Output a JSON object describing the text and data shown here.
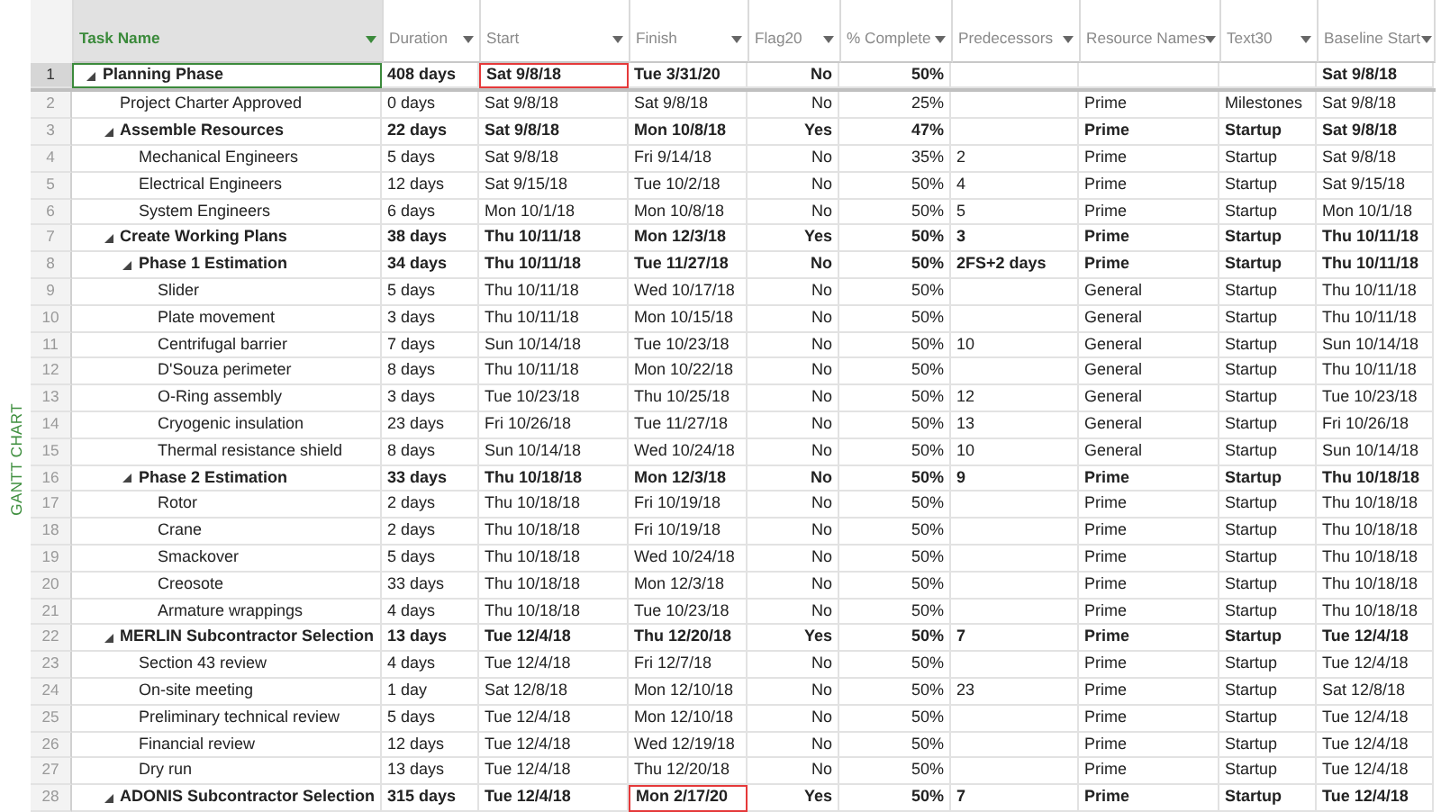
{
  "side_label": "GANTT CHART",
  "columns": [
    {
      "label": "Task Name",
      "selected": true
    },
    {
      "label": "Duration",
      "selected": false
    },
    {
      "label": "Start",
      "selected": false
    },
    {
      "label": "Finish",
      "selected": false
    },
    {
      "label": "Flag20",
      "selected": false
    },
    {
      "label": "% Complete",
      "selected": false
    },
    {
      "label": "Predecessors",
      "selected": false
    },
    {
      "label": "Resource Names",
      "selected": false
    },
    {
      "label": "Text30",
      "selected": false
    },
    {
      "label": "Baseline Start",
      "selected": false
    }
  ],
  "rows": [
    {
      "id": "1",
      "kind": "summary",
      "expanded": true,
      "selected": true,
      "task": "Planning Phase",
      "duration": "408 days",
      "start": {
        "text": "Sat 9/8/18",
        "outlined": true
      },
      "finish": "Tue 3/31/20",
      "flag20": "No",
      "complete": "50%",
      "baseline_start": "Sat 9/8/18",
      "children": [
        {
          "id": "2",
          "kind": "task",
          "selected": false,
          "task": "Project Charter Approved",
          "duration": "0 days",
          "start": "Sat 9/8/18",
          "finish": "Sat 9/8/18",
          "flag20": "No",
          "complete": "25%",
          "resources": "Prime",
          "text30": "Milestones",
          "baseline_start": "Sat 9/8/18"
        },
        {
          "id": "3",
          "kind": "summary",
          "expanded": true,
          "selected": false,
          "task": "Assemble Resources",
          "duration": "22 days",
          "start": "Sat 9/8/18",
          "finish": "Mon 10/8/18",
          "flag20": "Yes",
          "complete": "47%",
          "resources": "Prime",
          "text30": "Startup",
          "baseline_start": "Sat 9/8/18",
          "children": [
            {
              "id": "4",
              "kind": "task",
              "selected": false,
              "task": "Mechanical Engineers",
              "duration": "5 days",
              "start": "Sat 9/8/18",
              "finish": "Fri 9/14/18",
              "flag20": "No",
              "complete": "35%",
              "predecessors": "2",
              "resources": "Prime",
              "text30": "Startup",
              "baseline_start": "Sat 9/8/18"
            },
            {
              "id": "5",
              "kind": "task",
              "selected": false,
              "task": "Electrical Engineers",
              "duration": "12 days",
              "start": "Sat 9/15/18",
              "finish": "Tue 10/2/18",
              "flag20": "No",
              "complete": "50%",
              "predecessors": "4",
              "resources": "Prime",
              "text30": "Startup",
              "baseline_start": "Sat 9/15/18"
            },
            {
              "id": "6",
              "kind": "task",
              "selected": false,
              "task": "System Engineers",
              "duration": "6 days",
              "start": "Mon 10/1/18",
              "finish": "Mon 10/8/18",
              "flag20": "No",
              "complete": "50%",
              "predecessors": "5",
              "resources": "Prime",
              "text30": "Startup",
              "baseline_start": "Mon 10/1/18"
            }
          ]
        },
        {
          "id": "7",
          "kind": "summary",
          "expanded": true,
          "selected": false,
          "task": "Create Working Plans",
          "duration": "38 days",
          "start": "Thu 10/11/18",
          "finish": "Mon 12/3/18",
          "flag20": "Yes",
          "complete": "50%",
          "predecessors": "3",
          "resources": "Prime",
          "text30": "Startup",
          "baseline_start": "Thu 10/11/18",
          "children": [
            {
              "id": "8",
              "kind": "summary",
              "expanded": true,
              "selected": false,
              "task": "Phase 1 Estimation",
              "duration": "34 days",
              "start": "Thu 10/11/18",
              "finish": "Tue 11/27/18",
              "flag20": "No",
              "complete": "50%",
              "predecessors": "2FS+2 days",
              "resources": "Prime",
              "text30": "Startup",
              "baseline_start": "Thu 10/11/18",
              "children": [
                {
                  "id": "9",
                  "kind": "task",
                  "selected": false,
                  "task": "Slider",
                  "duration": "5 days",
                  "start": "Thu 10/11/18",
                  "finish": "Wed 10/17/18",
                  "flag20": "No",
                  "complete": "50%",
                  "resources": "General",
                  "text30": "Startup",
                  "baseline_start": "Thu 10/11/18"
                },
                {
                  "id": "10",
                  "kind": "task",
                  "selected": false,
                  "task": "Plate movement",
                  "duration": "3 days",
                  "start": "Thu 10/11/18",
                  "finish": "Mon 10/15/18",
                  "flag20": "No",
                  "complete": "50%",
                  "resources": "General",
                  "text30": "Startup",
                  "baseline_start": "Thu 10/11/18"
                },
                {
                  "id": "11",
                  "kind": "task",
                  "selected": false,
                  "task": "Centrifugal barrier",
                  "duration": "7 days",
                  "start": "Sun 10/14/18",
                  "finish": "Tue 10/23/18",
                  "flag20": "No",
                  "complete": "50%",
                  "predecessors": "10",
                  "resources": "General",
                  "text30": "Startup",
                  "baseline_start": "Sun 10/14/18"
                },
                {
                  "id": "12",
                  "kind": "task",
                  "selected": false,
                  "task": "D'Souza perimeter",
                  "duration": "8 days",
                  "start": "Thu 10/11/18",
                  "finish": "Mon 10/22/18",
                  "flag20": "No",
                  "complete": "50%",
                  "resources": "General",
                  "text30": "Startup",
                  "baseline_start": "Thu 10/11/18"
                },
                {
                  "id": "13",
                  "kind": "task",
                  "selected": false,
                  "task": "O-Ring assembly",
                  "duration": "3 days",
                  "start": "Tue 10/23/18",
                  "finish": "Thu 10/25/18",
                  "flag20": "No",
                  "complete": "50%",
                  "predecessors": "12",
                  "resources": "General",
                  "text30": "Startup",
                  "baseline_start": "Tue 10/23/18"
                },
                {
                  "id": "14",
                  "kind": "task",
                  "selected": false,
                  "task": "Cryogenic insulation",
                  "duration": "23 days",
                  "start": "Fri 10/26/18",
                  "finish": "Tue 11/27/18",
                  "flag20": "No",
                  "complete": "50%",
                  "predecessors": "13",
                  "resources": "General",
                  "text30": "Startup",
                  "baseline_start": "Fri 10/26/18"
                },
                {
                  "id": "15",
                  "kind": "task",
                  "selected": false,
                  "task": "Thermal resistance shield",
                  "duration": "8 days",
                  "start": "Sun 10/14/18",
                  "finish": "Wed 10/24/18",
                  "flag20": "No",
                  "complete": "50%",
                  "predecessors": "10",
                  "resources": "General",
                  "text30": "Startup",
                  "baseline_start": "Sun 10/14/18"
                }
              ]
            },
            {
              "id": "16",
              "kind": "summary",
              "expanded": true,
              "selected": false,
              "task": "Phase 2 Estimation",
              "duration": "33 days",
              "start": "Thu 10/18/18",
              "finish": "Mon 12/3/18",
              "flag20": "No",
              "complete": "50%",
              "predecessors": "9",
              "resources": "Prime",
              "text30": "Startup",
              "baseline_start": "Thu 10/18/18",
              "children": [
                {
                  "id": "17",
                  "kind": "task",
                  "selected": false,
                  "task": "Rotor",
                  "duration": "2 days",
                  "start": "Thu 10/18/18",
                  "finish": "Fri 10/19/18",
                  "flag20": "No",
                  "complete": "50%",
                  "resources": "Prime",
                  "text30": "Startup",
                  "baseline_start": "Thu 10/18/18"
                },
                {
                  "id": "18",
                  "kind": "task",
                  "selected": false,
                  "task": "Crane",
                  "duration": "2 days",
                  "start": "Thu 10/18/18",
                  "finish": "Fri 10/19/18",
                  "flag20": "No",
                  "complete": "50%",
                  "resources": "Prime",
                  "text30": "Startup",
                  "baseline_start": "Thu 10/18/18"
                },
                {
                  "id": "19",
                  "kind": "task",
                  "selected": false,
                  "task": "Smackover",
                  "duration": "5 days",
                  "start": "Thu 10/18/18",
                  "finish": "Wed 10/24/18",
                  "flag20": "No",
                  "complete": "50%",
                  "resources": "Prime",
                  "text30": "Startup",
                  "baseline_start": "Thu 10/18/18"
                },
                {
                  "id": "20",
                  "kind": "task",
                  "selected": false,
                  "task": "Creosote",
                  "duration": "33 days",
                  "start": "Thu 10/18/18",
                  "finish": "Mon 12/3/18",
                  "flag20": "No",
                  "complete": "50%",
                  "resources": "Prime",
                  "text30": "Startup",
                  "baseline_start": "Thu 10/18/18"
                },
                {
                  "id": "21",
                  "kind": "task",
                  "selected": false,
                  "task": "Armature wrappings",
                  "duration": "4 days",
                  "start": "Thu 10/18/18",
                  "finish": "Tue 10/23/18",
                  "flag20": "No",
                  "complete": "50%",
                  "resources": "Prime",
                  "text30": "Startup",
                  "baseline_start": "Thu 10/18/18"
                }
              ]
            }
          ]
        },
        {
          "id": "22",
          "kind": "summary",
          "expanded": true,
          "selected": false,
          "task": "MERLIN Subcontractor Selection",
          "duration": "13 days",
          "start": "Tue 12/4/18",
          "finish": "Thu 12/20/18",
          "flag20": "Yes",
          "complete": "50%",
          "predecessors": "7",
          "resources": "Prime",
          "text30": "Startup",
          "baseline_start": "Tue 12/4/18",
          "children": [
            {
              "id": "23",
              "kind": "task",
              "selected": false,
              "task": "Section 43 review",
              "duration": "4 days",
              "start": "Tue 12/4/18",
              "finish": "Fri 12/7/18",
              "flag20": "No",
              "complete": "50%",
              "resources": "Prime",
              "text30": "Startup",
              "baseline_start": "Tue 12/4/18"
            },
            {
              "id": "24",
              "kind": "task",
              "selected": false,
              "task": "On-site meeting",
              "duration": "1 day",
              "start": "Sat 12/8/18",
              "finish": "Mon 12/10/18",
              "flag20": "No",
              "complete": "50%",
              "predecessors": "23",
              "resources": "Prime",
              "text30": "Startup",
              "baseline_start": "Sat 12/8/18"
            },
            {
              "id": "25",
              "kind": "task",
              "selected": false,
              "task": "Preliminary technical review",
              "duration": "5 days",
              "start": "Tue 12/4/18",
              "finish": "Mon 12/10/18",
              "flag20": "No",
              "complete": "50%",
              "resources": "Prime",
              "text30": "Startup",
              "baseline_start": "Tue 12/4/18"
            },
            {
              "id": "26",
              "kind": "task",
              "selected": false,
              "task": "Financial review",
              "duration": "12 days",
              "start": "Tue 12/4/18",
              "finish": "Wed 12/19/18",
              "flag20": "No",
              "complete": "50%",
              "resources": "Prime",
              "text30": "Startup",
              "baseline_start": "Tue 12/4/18"
            },
            {
              "id": "27",
              "kind": "task",
              "selected": false,
              "task": "Dry run",
              "duration": "13 days",
              "start": "Tue 12/4/18",
              "finish": "Thu 12/20/18",
              "flag20": "No",
              "complete": "50%",
              "resources": "Prime",
              "text30": "Startup",
              "baseline_start": "Tue 12/4/18"
            }
          ]
        },
        {
          "id": "28",
          "kind": "summary",
          "expanded": true,
          "selected": false,
          "task": "ADONIS Subcontractor Selection",
          "duration": "315 days",
          "start": "Tue 12/4/18",
          "finish": {
            "text": "Mon 2/17/20",
            "outlined": true
          },
          "flag20": "Yes",
          "complete": "50%",
          "predecessors": "7",
          "resources": "Prime",
          "text30": "Startup",
          "baseline_start": "Tue 12/4/18"
        }
      ]
    }
  ]
}
